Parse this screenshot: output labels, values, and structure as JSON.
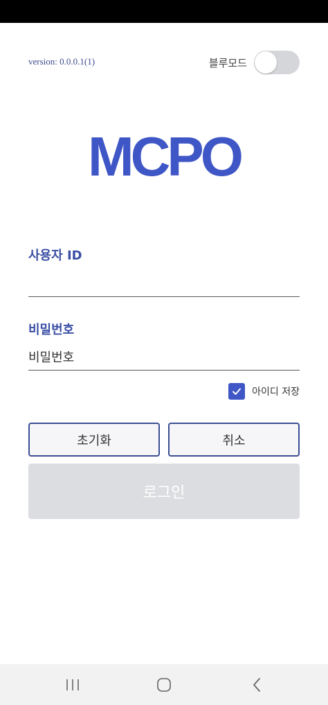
{
  "header": {
    "version": "version: 0.0.0.1(1)",
    "blue_mode_label": "블루모드",
    "blue_mode_on": false
  },
  "logo": {
    "text": "MCPO",
    "color": "#3f56c6"
  },
  "form": {
    "user_id": {
      "label": "사용자 ID",
      "value": "",
      "placeholder": ""
    },
    "password": {
      "label": "비밀번호",
      "value": "",
      "placeholder": "비밀번호"
    },
    "save_id": {
      "label": "아이디 저장",
      "checked": true
    }
  },
  "buttons": {
    "reset_label": "초기화",
    "cancel_label": "취소",
    "login_label": "로그인"
  },
  "icons": {
    "nav_recents": "recent-apps-icon",
    "nav_home": "home-icon",
    "nav_back": "back-icon",
    "check": "check-icon"
  },
  "colors": {
    "accent": "#3f56c6",
    "label": "#3a4ea3",
    "button_border": "#3a4e93",
    "login_disabled": "#dcdde0"
  }
}
